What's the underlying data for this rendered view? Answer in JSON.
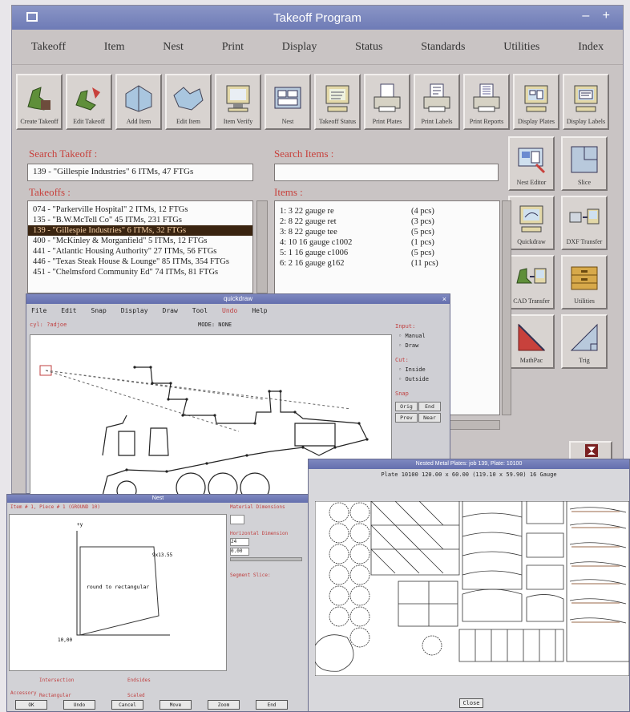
{
  "window": {
    "title": "Takeoff Program",
    "controls": "– +"
  },
  "menu": [
    "Takeoff",
    "Item",
    "Nest",
    "Print",
    "Display",
    "Status",
    "Standards",
    "Utilities",
    "Index"
  ],
  "toolbar": [
    {
      "label": "Create Takeoff",
      "icon": "create-takeoff-icon"
    },
    {
      "label": "Edit Takeoff",
      "icon": "edit-takeoff-icon"
    },
    {
      "label": "Add Item",
      "icon": "add-item-icon"
    },
    {
      "label": "Edit Item",
      "icon": "edit-item-icon"
    },
    {
      "label": "Item Verify",
      "icon": "item-verify-icon"
    },
    {
      "label": "Nest",
      "icon": "nest-icon"
    },
    {
      "label": "Takeoff Status",
      "icon": "takeoff-status-icon"
    },
    {
      "label": "Print Plates",
      "icon": "print-plates-icon"
    },
    {
      "label": "Print Labels",
      "icon": "print-labels-icon"
    },
    {
      "label": "Print Reports",
      "icon": "print-reports-icon"
    },
    {
      "label": "Display Plates",
      "icon": "display-plates-icon"
    },
    {
      "label": "Display Labels",
      "icon": "display-labels-icon"
    }
  ],
  "side_tools": [
    {
      "label": "Nest Editor",
      "icon": "nest-editor-icon"
    },
    {
      "label": "Slice",
      "icon": "slice-icon"
    },
    {
      "label": "Quickdraw",
      "icon": "quickdraw-icon"
    },
    {
      "label": "DXF Transfer",
      "icon": "dxf-transfer-icon"
    },
    {
      "label": "CAD Transfer",
      "icon": "cad-transfer-icon"
    },
    {
      "label": "Utilities",
      "icon": "utilities-icon"
    },
    {
      "label": "MathPac",
      "icon": "mathpac-icon"
    },
    {
      "label": "Trig",
      "icon": "trig-icon"
    }
  ],
  "search_takeoff": {
    "label": "Search Takeoff :",
    "value": "139 - \"Gillespie Industries\" 6 ITMs, 47 FTGs"
  },
  "search_items": {
    "label": "Search Items :",
    "value": ""
  },
  "takeoffs": {
    "label": "Takeoffs :",
    "rows": [
      "074 - \"Parkerville Hospital\" 2 ITMs, 12 FTGs",
      "135 - \"B.W.McTell Co\" 45 ITMs, 231 FTGs",
      "139 - \"Gillespie Industries\" 6 ITMs, 32 FTGs",
      "400 - \"McKinley & Morganfield\" 5 ITMs, 12 FTGs",
      "441 - \"Atlantic Housing Authority\" 27 ITMs, 56 FTGs",
      "446 - \"Texas Steak House & Lounge\" 85 ITMs, 354 FTGs",
      "451 - \"Chelmsford Community Ed\" 74 ITMs, 81 FTGs"
    ],
    "selected": 2
  },
  "items": {
    "label": "Items :",
    "rows": [
      {
        "desc": "1: 3  22 gauge re",
        "qty": "(4 pcs)"
      },
      {
        "desc": "2: 8  22 gauge ret",
        "qty": "(3 pcs)"
      },
      {
        "desc": "3: 8  22 gauge tee",
        "qty": "(5 pcs)"
      },
      {
        "desc": "4: 10 16 gauge c1002",
        "qty": "(1 pcs)"
      },
      {
        "desc": "5: 1  16 gauge c1006",
        "qty": "(5 pcs)"
      },
      {
        "desc": "6: 2  16 gauge g162",
        "qty": "(11 pcs)"
      }
    ]
  },
  "quickdraw": {
    "title": "quickdraw",
    "menu": [
      "File",
      "Edit",
      "Snap",
      "Display",
      "Draw",
      "Tool",
      "Undo",
      "Help"
    ],
    "left_status": "cyl: ?adjoe",
    "mode": "MODE: NONE",
    "input_label": "Input:",
    "input_options": [
      "Manual",
      "Draw"
    ],
    "cut_label": "Cut:",
    "cut_options": [
      "Inside",
      "Outside"
    ],
    "snap_label": "Snap",
    "buttons": [
      "Orig",
      "End",
      "Prev",
      "Near"
    ]
  },
  "nest": {
    "title": "Nest",
    "info": "Item # 1, Piece # 1 (GROUND 10)",
    "shape_text": "round to rectangular",
    "right_labels": [
      "Material Dimensions",
      "Horizontal Dimension",
      "Segment Slice:"
    ],
    "right_values": [
      "24",
      "0.00"
    ],
    "legend": [
      "Intersection",
      "Endsides",
      "Rectangular",
      "Scaled"
    ],
    "buttons_label": "Accessory",
    "buttons": [
      "OK",
      "Undo",
      "Cancel",
      "Move",
      "Zoom",
      "End"
    ],
    "axis_top": "+y",
    "axis_origin": "10,00",
    "corner_label": "9x13.55"
  },
  "plate": {
    "title": "Nested Metal Plates: job 139,  Plate: 10100",
    "header": "Plate 10100 120.00 x 60.00 (119.10 x 59.90) 16 Gauge",
    "close": "Close"
  }
}
